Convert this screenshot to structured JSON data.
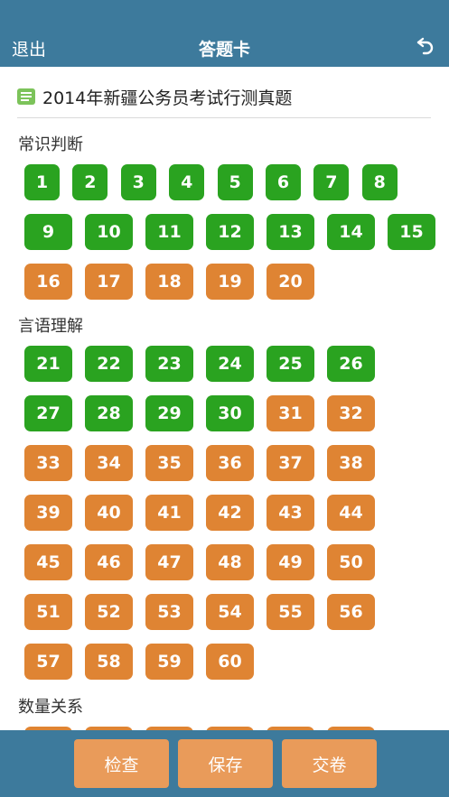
{
  "header": {
    "back_label": "退出",
    "title": "答题卡",
    "undo_icon": "undo-icon"
  },
  "exam_title": "2014年新疆公务员考试行测真题",
  "colors": {
    "header": "#3d7a9c",
    "answered": "#2aa320",
    "unanswered": "#df8433",
    "footer_button": "#e99b5a"
  },
  "sections": [
    {
      "label": "常识判断",
      "answered": [
        "1",
        "2",
        "3",
        "4",
        "5",
        "6",
        "7",
        "8",
        "9",
        "10",
        "11",
        "12",
        "13",
        "14",
        "15"
      ],
      "unanswered": [
        "16",
        "17",
        "18",
        "19",
        "20"
      ]
    },
    {
      "label": "言语理解",
      "answered": [
        "21",
        "22",
        "23",
        "24",
        "25",
        "26",
        "27",
        "28",
        "29",
        "30"
      ],
      "unanswered": [
        "31",
        "32",
        "33",
        "34",
        "35",
        "36",
        "37",
        "38",
        "39",
        "40",
        "41",
        "42",
        "43",
        "44",
        "45",
        "46",
        "47",
        "48",
        "49",
        "50",
        "51",
        "52",
        "53",
        "54",
        "55",
        "56",
        "57",
        "58",
        "59",
        "60"
      ]
    },
    {
      "label": "数量关系"
    }
  ],
  "footer": {
    "check_label": "检查",
    "save_label": "保存",
    "submit_label": "交卷"
  }
}
